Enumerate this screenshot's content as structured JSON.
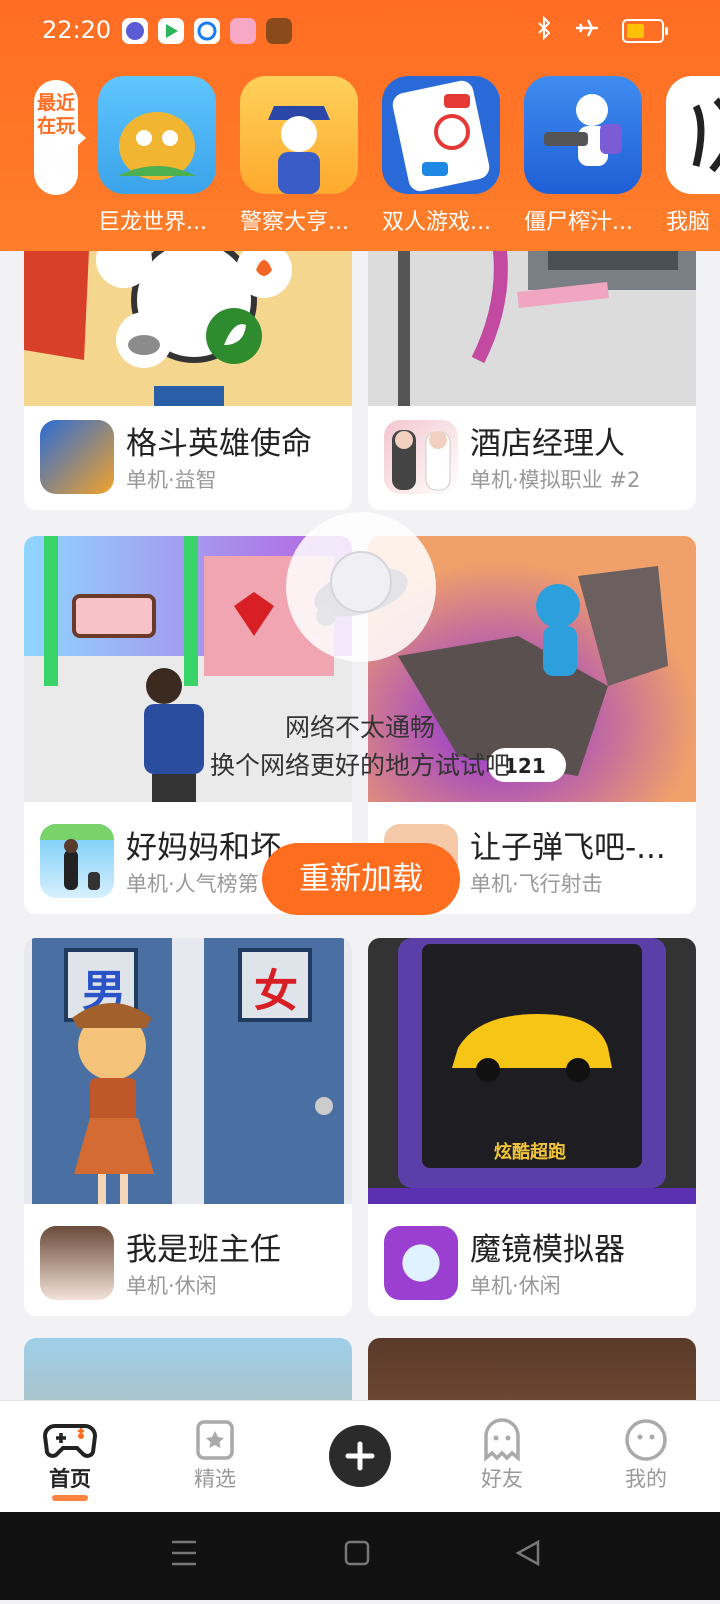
{
  "status_bar": {
    "time": "22:20",
    "notification_icons": [
      "browser-icon",
      "video-app-icon",
      "messenger-icon",
      "pig-app-icon",
      "game-app-icon"
    ],
    "right_icons": [
      "bluetooth-icon",
      "airplane-mode-icon",
      "battery-icon"
    ]
  },
  "recent": {
    "tab_label": "最近在玩",
    "games": [
      {
        "name": "巨龙世界...",
        "icon": "dragon-game-icon"
      },
      {
        "name": "警察大亨...",
        "icon": "police-game-icon"
      },
      {
        "name": "双人游戏...",
        "icon": "two-player-game-icon"
      },
      {
        "name": "僵尸榨汁...",
        "icon": "zombie-game-icon"
      },
      {
        "name": "我脑",
        "icon": "brain-game-icon"
      }
    ]
  },
  "feed": {
    "cards": [
      {
        "name": "格斗英雄使命",
        "tag": "单机·益智"
      },
      {
        "name": "酒店经理人",
        "tag": "单机·模拟职业 #2"
      },
      {
        "name": "好妈妈和坏",
        "tag": "单机·人气榜第"
      },
      {
        "name": "让子弹飞吧-...",
        "tag": "单机·飞行射击"
      },
      {
        "name": "我是班主任",
        "tag": "单机·休闲"
      },
      {
        "name": "魔镜模拟器",
        "tag": "单机·休闲"
      }
    ],
    "thumb_texts": {
      "door_sign_left": "男",
      "door_sign_right": "女",
      "car_caption": "炫酷超跑",
      "count_badge": "121"
    }
  },
  "error": {
    "line1": "网络不太通畅",
    "line2": "换个网络更好的地方试试吧",
    "reload_label": "重新加载"
  },
  "nav": {
    "home": "首页",
    "featured": "精选",
    "friends": "好友",
    "me": "我的"
  },
  "colors": {
    "accent": "#ff6d1f",
    "header": "#ff7a29"
  }
}
